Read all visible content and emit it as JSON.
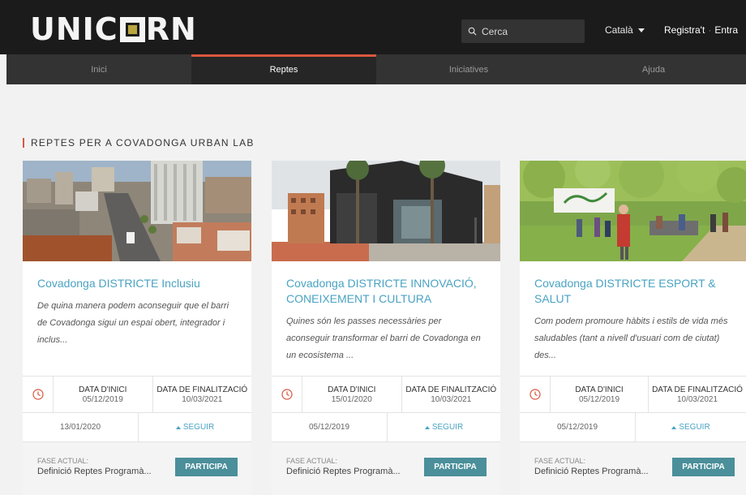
{
  "header": {
    "logo_left": "UNIC",
    "logo_right": "RN",
    "search_placeholder": "Cerca",
    "language": "Català",
    "register": "Registra't",
    "login": "Entra"
  },
  "nav": [
    {
      "label": "Inici",
      "active": false
    },
    {
      "label": "Reptes",
      "active": true
    },
    {
      "label": "Iniciatives",
      "active": false
    },
    {
      "label": "Ajuda",
      "active": false
    }
  ],
  "section_title": "REPTES PER A COVADONGA URBAN LAB",
  "common": {
    "start_label": "DATA D'INICI",
    "end_label": "DATA DE FINALITZACIÓ",
    "follow_label": "SEGUIR",
    "phase_label": "FASE ACTUAL:",
    "cta": "PARTICIPA"
  },
  "cards": [
    {
      "title": "Covadonga DISTRICTE Inclusiu",
      "description": "De quina manera podem aconseguir que el barri de Covadonga sigui un espai obert, integrador i inclus...",
      "start_date": "05/12/2019",
      "end_date": "10/03/2021",
      "created": "13/01/2020",
      "phase": "Definició Reptes Programà..."
    },
    {
      "title": "Covadonga DISTRICTE INNOVACIÓ, CONEIXEMENT I CULTURA",
      "description": "Quines són les passes necessàries per aconseguir transformar el barri de Covadonga en un ecosistema ...",
      "start_date": "15/01/2020",
      "end_date": "10/03/2021",
      "created": "05/12/2019",
      "phase": "Definició Reptes Programà..."
    },
    {
      "title": "Covadonga DISTRICTE ESPORT & SALUT",
      "description": "Com podem promoure hàbits i estils de vida més saludables (tant a nivell d'usuari com de ciutat) des...",
      "start_date": "05/12/2019",
      "end_date": "10/03/2021",
      "created": "05/12/2019",
      "phase": "Definició Reptes Programà..."
    }
  ],
  "colors": {
    "accent": "#d9573f",
    "link": "#4aa3c2",
    "button": "#4a8f9a",
    "logo_mark": "#b9a53e"
  }
}
